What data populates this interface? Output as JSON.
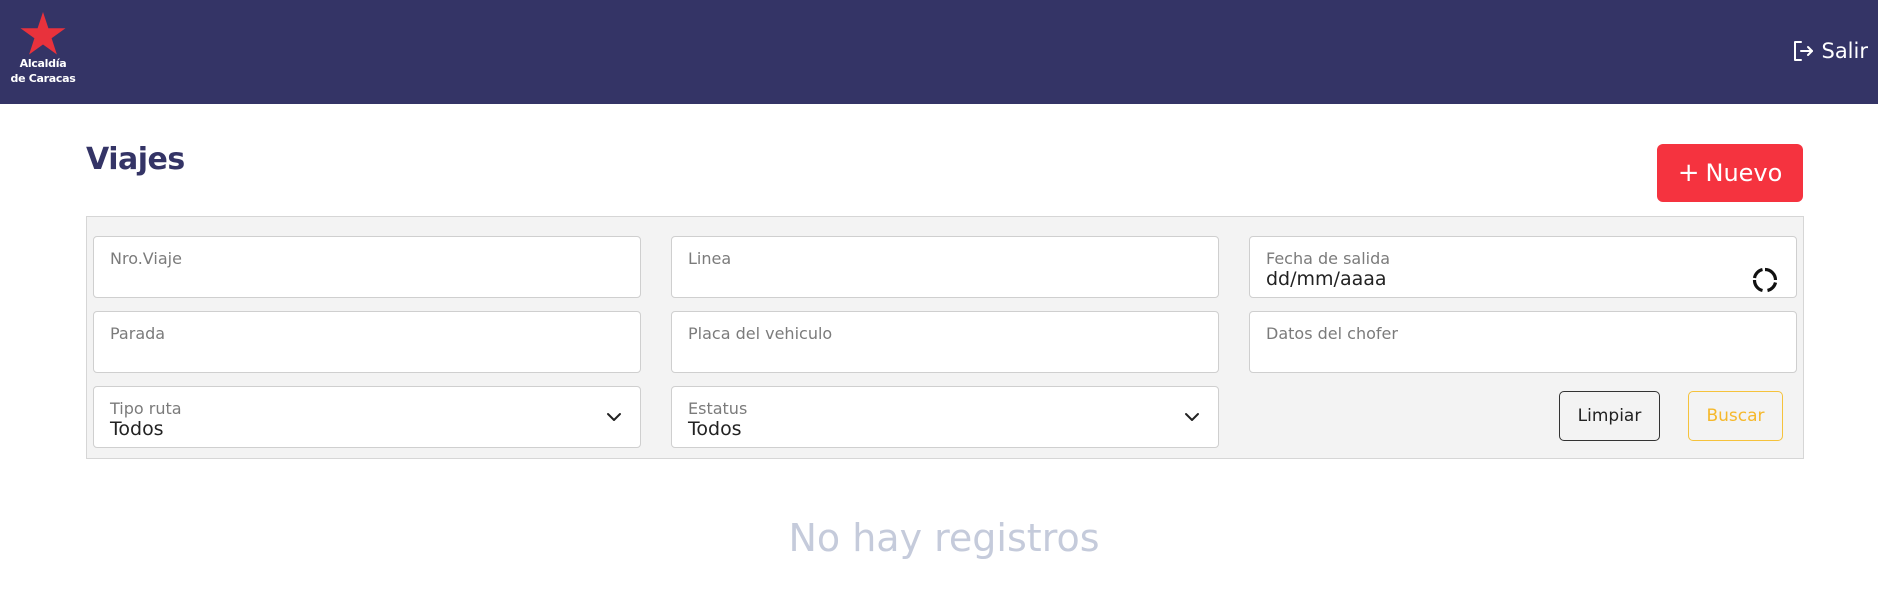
{
  "header": {
    "logo_line1": "Alcaldía",
    "logo_line2": "de Caracas",
    "logout_label": "Salir"
  },
  "page": {
    "title": "Viajes",
    "new_button_label": "Nuevo"
  },
  "filters": {
    "nro_viaje": {
      "label": "Nro.Viaje",
      "value": ""
    },
    "linea": {
      "label": "Linea",
      "value": ""
    },
    "fecha_salida": {
      "label": "Fecha de salida",
      "value": "dd/mm/aaaa"
    },
    "parada": {
      "label": "Parada",
      "value": ""
    },
    "placa": {
      "label": "Placa del vehiculo",
      "value": ""
    },
    "chofer": {
      "label": "Datos del chofer",
      "value": ""
    },
    "tipo_ruta": {
      "label": "Tipo ruta",
      "selected": "Todos"
    },
    "estatus": {
      "label": "Estatus",
      "selected": "Todos"
    },
    "clear_label": "Limpiar",
    "search_label": "Buscar"
  },
  "results": {
    "empty_message": "No hay registros"
  },
  "colors": {
    "header_bg": "#343466",
    "brand_red": "#f5333f",
    "title": "#343466",
    "search_accent": "#f5b82b",
    "empty_text": "#c5cbdb"
  },
  "icons": {
    "logo": "red-star-icon",
    "logout": "logout-arrow-icon",
    "date_loading": "loading-spinner-icon",
    "select": "chevron-down-icon"
  }
}
